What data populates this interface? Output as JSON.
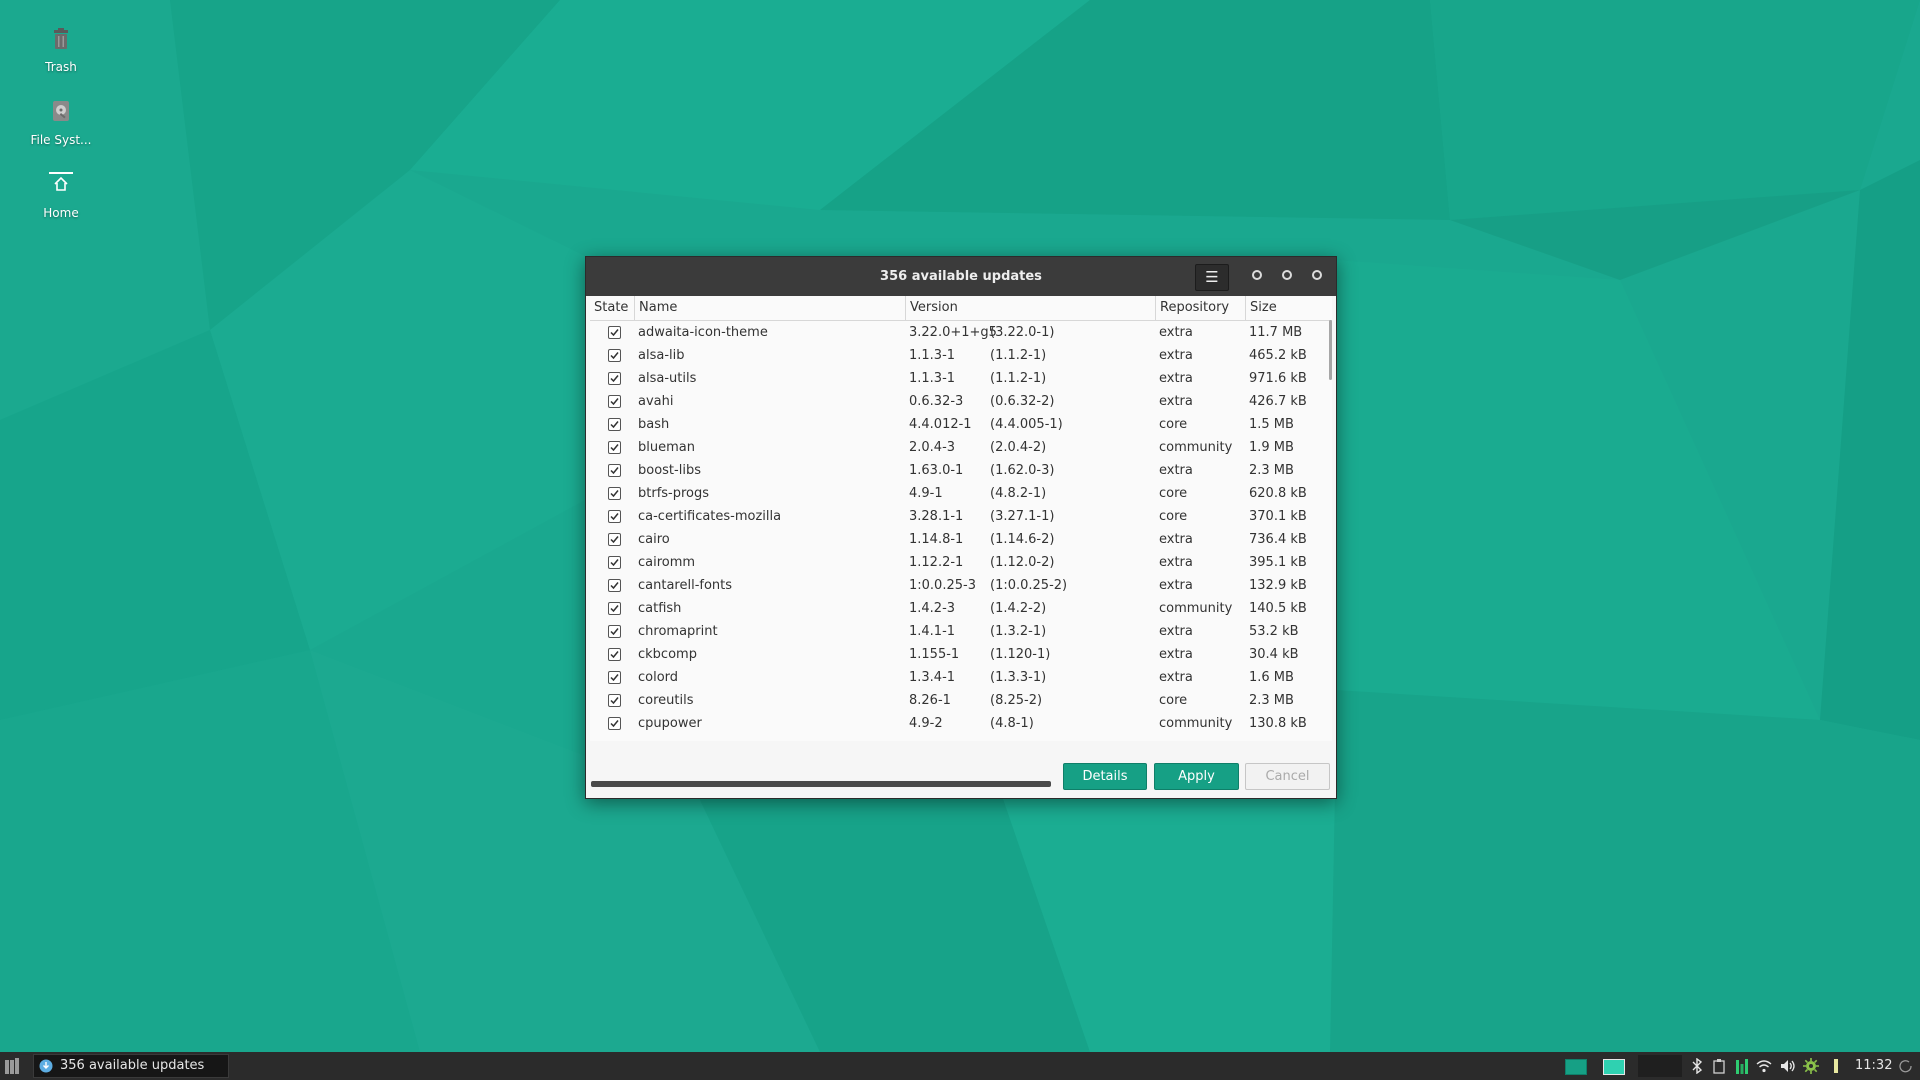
{
  "colors": {
    "desktop_bg": "#1aa88f",
    "accent": "#16a085",
    "titlebar": "#3b3b3b"
  },
  "desktop": {
    "icons": [
      {
        "label": "Trash",
        "icon": "trash-icon"
      },
      {
        "label": "File Syst...",
        "icon": "file-system-icon"
      },
      {
        "label": "Home",
        "icon": "home-icon"
      }
    ]
  },
  "window": {
    "title": "356 available updates",
    "menu_icon": "hamburger-menu-icon",
    "columns": [
      "State",
      "Name",
      "Version",
      "Repository",
      "Size"
    ],
    "rows": [
      {
        "name": "adwaita-icon-theme",
        "version": "3.22.0+1+g5",
        "old_version": "(3.22.0-1)",
        "repo": "extra",
        "size": "11.7 MB"
      },
      {
        "name": "alsa-lib",
        "version": "1.1.3-1",
        "old_version": "(1.1.2-1)",
        "repo": "extra",
        "size": "465.2 kB"
      },
      {
        "name": "alsa-utils",
        "version": "1.1.3-1",
        "old_version": "(1.1.2-1)",
        "repo": "extra",
        "size": "971.6 kB"
      },
      {
        "name": "avahi",
        "version": "0.6.32-3",
        "old_version": "(0.6.32-2)",
        "repo": "extra",
        "size": "426.7 kB"
      },
      {
        "name": "bash",
        "version": "4.4.012-1",
        "old_version": "(4.4.005-1)",
        "repo": "core",
        "size": "1.5 MB"
      },
      {
        "name": "blueman",
        "version": "2.0.4-3",
        "old_version": "(2.0.4-2)",
        "repo": "community",
        "size": "1.9 MB"
      },
      {
        "name": "boost-libs",
        "version": "1.63.0-1",
        "old_version": "(1.62.0-3)",
        "repo": "extra",
        "size": "2.3 MB"
      },
      {
        "name": "btrfs-progs",
        "version": "4.9-1",
        "old_version": "(4.8.2-1)",
        "repo": "core",
        "size": "620.8 kB"
      },
      {
        "name": "ca-certificates-mozilla",
        "version": "3.28.1-1",
        "old_version": "(3.27.1-1)",
        "repo": "core",
        "size": "370.1 kB"
      },
      {
        "name": "cairo",
        "version": "1.14.8-1",
        "old_version": "(1.14.6-2)",
        "repo": "extra",
        "size": "736.4 kB"
      },
      {
        "name": "cairomm",
        "version": "1.12.2-1",
        "old_version": "(1.12.0-2)",
        "repo": "extra",
        "size": "395.1 kB"
      },
      {
        "name": "cantarell-fonts",
        "version": "1:0.0.25-3",
        "old_version": "(1:0.0.25-2)",
        "repo": "extra",
        "size": "132.9 kB"
      },
      {
        "name": "catfish",
        "version": "1.4.2-3",
        "old_version": "(1.4.2-2)",
        "repo": "community",
        "size": "140.5 kB"
      },
      {
        "name": "chromaprint",
        "version": "1.4.1-1",
        "old_version": "(1.3.2-1)",
        "repo": "extra",
        "size": "53.2 kB"
      },
      {
        "name": "ckbcomp",
        "version": "1.155-1",
        "old_version": "(1.120-1)",
        "repo": "extra",
        "size": "30.4 kB"
      },
      {
        "name": "colord",
        "version": "1.3.4-1",
        "old_version": "(1.3.3-1)",
        "repo": "extra",
        "size": "1.6 MB"
      },
      {
        "name": "coreutils",
        "version": "8.26-1",
        "old_version": "(8.25-2)",
        "repo": "core",
        "size": "2.3 MB"
      },
      {
        "name": "cpupower",
        "version": "4.9-2",
        "old_version": "(4.8-1)",
        "repo": "community",
        "size": "130.8 kB"
      }
    ],
    "buttons": {
      "details": "Details",
      "apply": "Apply",
      "cancel": "Cancel"
    }
  },
  "taskbar": {
    "task_label": "356 available updates",
    "clock": "11:32"
  }
}
